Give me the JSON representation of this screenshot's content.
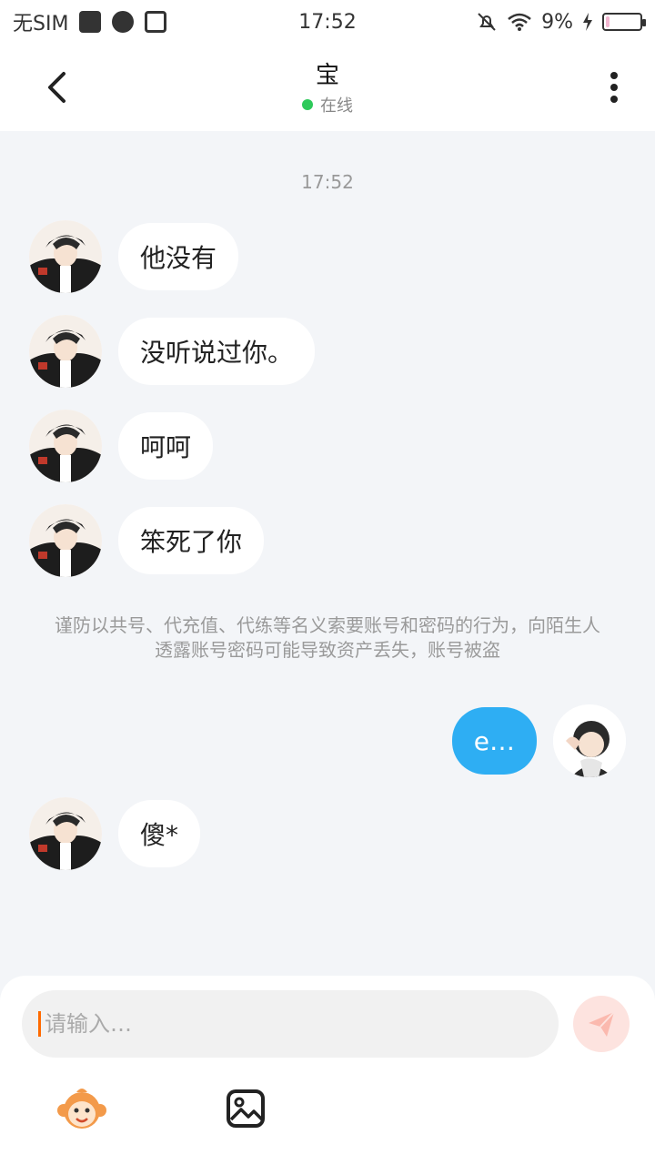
{
  "status_bar": {
    "carrier": "无SIM",
    "time": "17:52",
    "battery": "9%",
    "battery_level": 0.09
  },
  "header": {
    "title": "宝",
    "status": "在线"
  },
  "chat": {
    "timestamp": "17:52",
    "messages_before": [
      {
        "text": "他没有"
      },
      {
        "text": "没听说过你。"
      },
      {
        "text": "呵呵"
      },
      {
        "text": "笨死了你"
      }
    ],
    "notice": "谨防以共号、代充值、代练等名义索要账号和密码的行为，向陌生人透露账号密码可能导致资产丢失，账号被盗",
    "my_message": "e…",
    "last_message": "傻*"
  },
  "composer": {
    "placeholder": "请输入…"
  },
  "colors": {
    "online": "#2ec95a",
    "my_bubble": "#2eaef3",
    "caret": "#ff6a00",
    "send": "#fde3df"
  }
}
